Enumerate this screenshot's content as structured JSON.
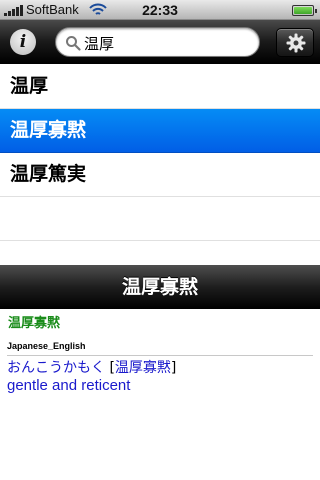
{
  "status_bar": {
    "carrier": "SoftBank",
    "time": "22:33"
  },
  "toolbar": {
    "info_label": "i",
    "search": {
      "value": "温厚",
      "placeholder": ""
    },
    "icons": {
      "info": "info-icon",
      "search": "magnifier-icon",
      "settings": "gear-icon"
    }
  },
  "results": [
    {
      "label": "温厚"
    },
    {
      "label": "温厚寡黙",
      "selected": true
    },
    {
      "label": "温厚篤実"
    }
  ],
  "detail": {
    "title": "温厚寡黙",
    "headword": "温厚寡黙",
    "dictionary": "Japanese_English",
    "reading": "おんこうかもく",
    "bracket_open": "[",
    "linked_word": "温厚寡黙",
    "bracket_close": "]",
    "translation": "gentle and reticent"
  },
  "colors": {
    "selected_row": "#0a6ff0",
    "headword": "#1a8c1a",
    "link": "#1a1acc"
  }
}
